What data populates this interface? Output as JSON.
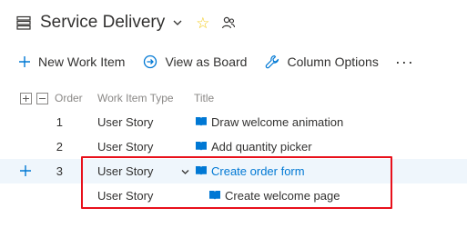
{
  "header": {
    "title": "Service Delivery"
  },
  "toolbar": {
    "new_work_item": "New Work Item",
    "view_as_board": "View as Board",
    "column_options": "Column Options",
    "more": "···"
  },
  "columns": {
    "order": "Order",
    "type": "Work Item Type",
    "title": "Title"
  },
  "rows": [
    {
      "order": "1",
      "type": "User Story",
      "title": "Draw welcome animation"
    },
    {
      "order": "2",
      "type": "User Story",
      "title": "Add quantity picker"
    },
    {
      "order": "3",
      "type": "User Story",
      "title": "Create order form"
    },
    {
      "order": "",
      "type": "User Story",
      "title": "Create welcome page"
    }
  ],
  "colors": {
    "accent": "#0078d4",
    "highlight": "#e8101b",
    "selected_row": "#eff6fc",
    "star": "#f2c811"
  }
}
